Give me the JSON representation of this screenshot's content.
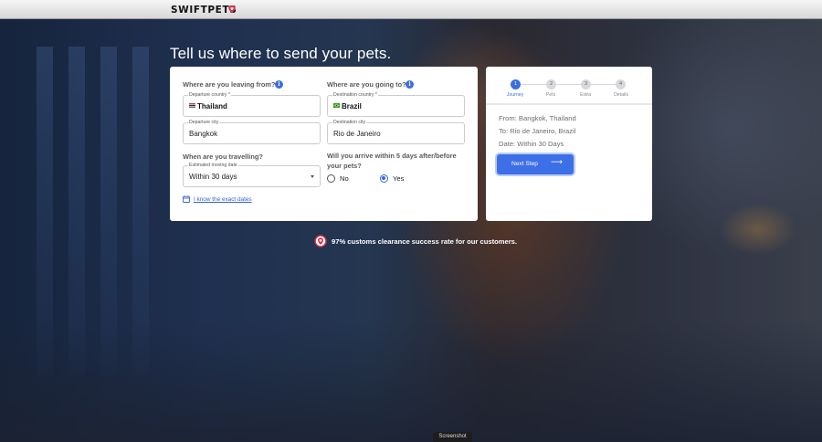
{
  "header": {
    "logo_text": "SWIFTPETS",
    "logo_mark_icon": "pin-heart-icon",
    "brand_color": "#d6344b"
  },
  "hero": {
    "title": "Tell us where to send your pets."
  },
  "form": {
    "leaving_question": "Where are you leaving from?",
    "going_question": "Where are you going to?",
    "info_icon_text": "i",
    "departure_country": {
      "label": "Departure country *",
      "value": "Thailand",
      "flag_icon": "thailand-flag-icon"
    },
    "destination_country": {
      "label": "Destination country *",
      "value": "Brazil",
      "flag_icon": "brazil-flag-icon"
    },
    "departure_city": {
      "label": "Departure city",
      "value": "Bangkok"
    },
    "destination_city": {
      "label": "Destination city",
      "value": "Rio de Janeiro"
    },
    "travel_question": "When are you travelling?",
    "moving_date": {
      "label": "Estimated moving date",
      "value": "Within 30 days"
    },
    "arrive_question_line1": "Will you arrive within 5 days after/before",
    "arrive_question_line2": "your pets?",
    "radio_no": "No",
    "radio_yes": "Yes",
    "selected_radio": "Yes",
    "exact_dates_link": "I know the exact dates",
    "calendar_icon": "calendar-icon"
  },
  "summary": {
    "steps": [
      {
        "num": "1",
        "label": "Journey"
      },
      {
        "num": "2",
        "label": "Pets"
      },
      {
        "num": "3",
        "label": "Extra"
      },
      {
        "num": "4",
        "label": "Details"
      }
    ],
    "active_step": 1,
    "from": "From: Bangkok, Thailand",
    "to": "To: Rio de Janeiro, Brazil",
    "date": "Date: Within 30 Days",
    "next_button": "Next Step",
    "next_arrow": "⟶",
    "accent_color": "#3d6fe6"
  },
  "footer": {
    "clearance_text": "97% customs clearance success rate for our customers.",
    "badge_icon": "pin-heart-badge-icon"
  },
  "screenshot_tag": "Screenshot"
}
